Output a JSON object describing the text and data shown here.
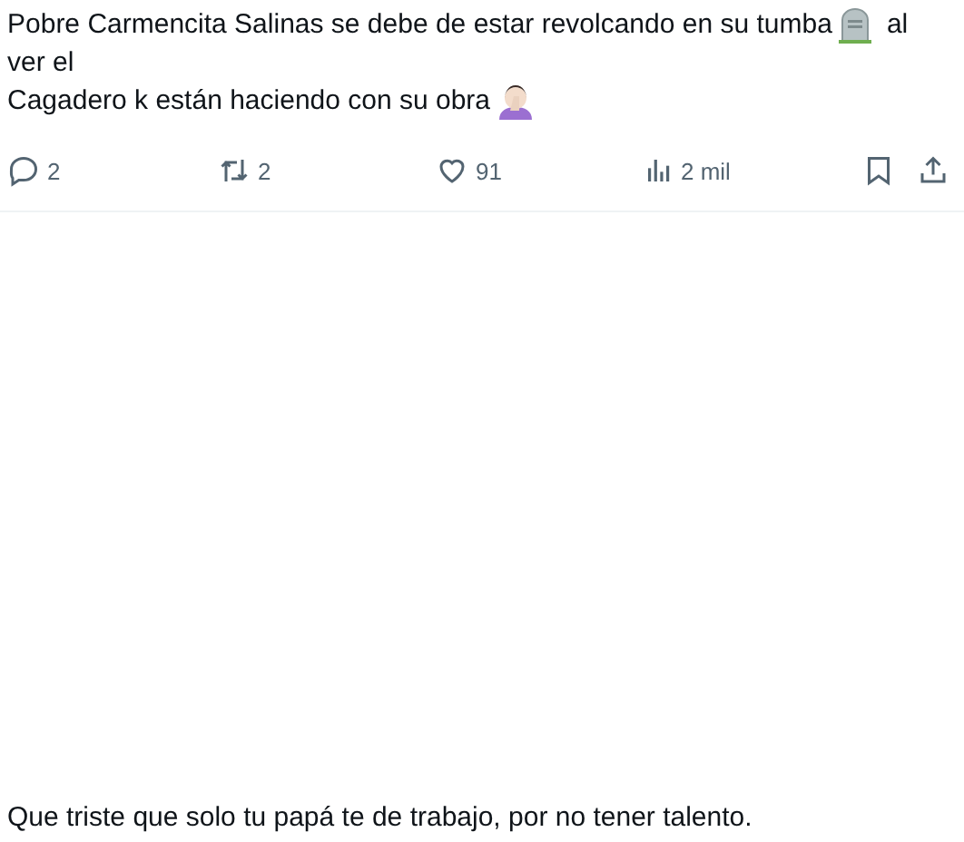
{
  "tweet": {
    "lines": [
      {
        "kind": "tombstone",
        "text": "Pobre Carmencita Salinas se debe de estar revolcando en su tumba",
        "after": "al"
      },
      {
        "kind": "plain",
        "text": "ver el"
      },
      {
        "kind": "facepalm",
        "text": "Cagadero k están haciendo con su obra"
      }
    ],
    "actions": [
      {
        "kind": "reply",
        "count": "2"
      },
      {
        "kind": "repost",
        "count": "2"
      },
      {
        "kind": "like",
        "count": "91"
      },
      {
        "kind": "views",
        "count": "2 mil"
      },
      {
        "kind": "bookmark"
      },
      {
        "kind": "share"
      }
    ]
  },
  "reply": {
    "text": "Que triste que solo tu papá te de trabajo, por no tener talento."
  }
}
